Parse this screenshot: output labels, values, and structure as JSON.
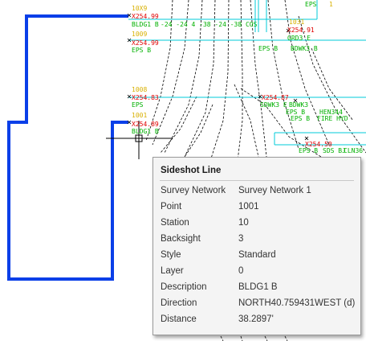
{
  "drawing_labels": {
    "block_tl": {
      "code": "BLDG1 B",
      "elev": "X254.99",
      "note": "-24 -24 4 -38 -24 -38 COS",
      "top_tag": "10X9"
    },
    "block_ml": {
      "elev": "X254.99",
      "code": "EPS B",
      "top_tag": "1009"
    },
    "block_c": {
      "elev": "X254.83",
      "code": "EPS",
      "tag": "1008"
    },
    "block_bl": {
      "elev": "X254.89",
      "code": "BLDG1 B",
      "tag": "1001"
    },
    "right_1": {
      "tag": "1031",
      "elev": "X254.91",
      "code": "GRD3 E"
    },
    "right_2": {
      "code": "EPS B",
      "code2": "BDWK3 B"
    },
    "right_3": {
      "elev": "X254.87",
      "code": "SDWK3 E"
    },
    "right_4": {
      "code": "EPS B",
      "code2": "BDWK3"
    },
    "right_5": {
      "code": "EPS B",
      "code2": "FIRE HYD",
      "code3": "HEN344"
    },
    "right_6": {
      "elev": "X254.50",
      "code": "EPS B",
      "code2": "SDS BJ",
      "code3": "CLN36"
    },
    "top_right": {
      "code": "EPS",
      "tag": "1"
    }
  },
  "tooltip": {
    "title": "Sideshot Line",
    "rows": [
      {
        "key": "Survey Network",
        "value": "Survey Network 1"
      },
      {
        "key": "Point",
        "value": "1001"
      },
      {
        "key": "Station",
        "value": "10"
      },
      {
        "key": "Backsight",
        "value": "3"
      },
      {
        "key": "Style",
        "value": "Standard"
      },
      {
        "key": "Layer",
        "value": "0"
      },
      {
        "key": "Description",
        "value": "BLDG1 B"
      },
      {
        "key": "Direction",
        "value": "NORTH40.759431WEST (d)"
      },
      {
        "key": "Distance",
        "value": "38.2897'"
      }
    ]
  },
  "colors": {
    "building_outline": "#0a3fe8",
    "code_text": "#00b000",
    "elev_text": "#e00000",
    "tag_text": "#d8b000",
    "cyan_line": "#00cbd8",
    "dashed": "#000000"
  }
}
